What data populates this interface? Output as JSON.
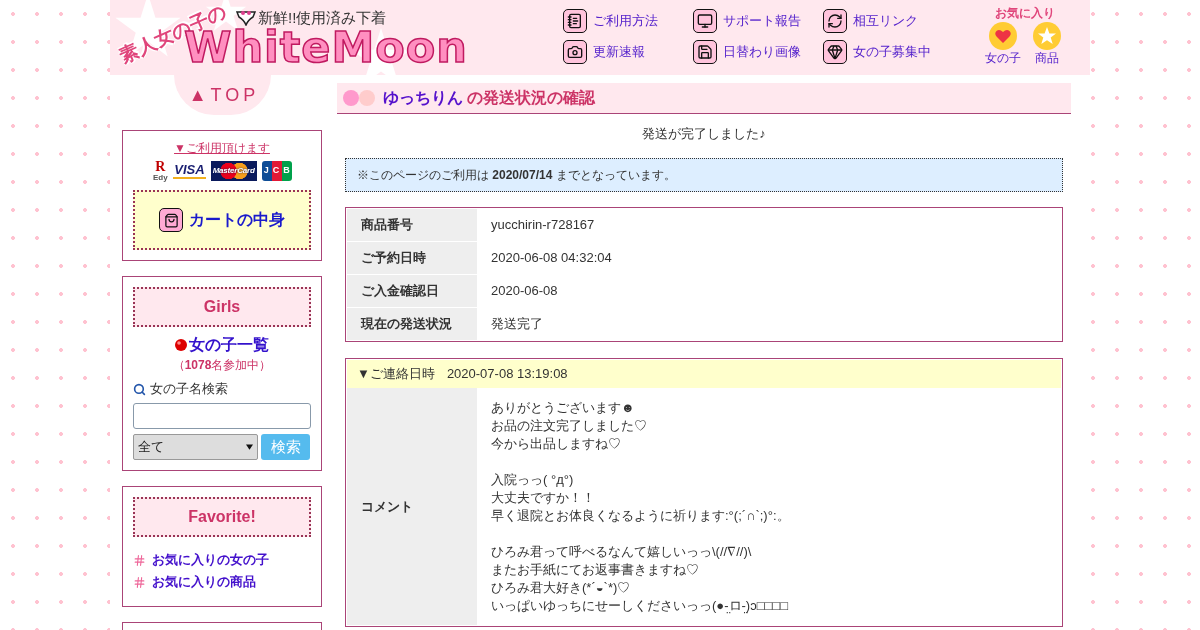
{
  "header": {
    "logo": {
      "subtitle": "素人女の子の",
      "title": "WhiteMoon",
      "tagline": "新鮮!!使用済み下着"
    },
    "nav": [
      {
        "label": "ご利用方法"
      },
      {
        "label": "サポート報告"
      },
      {
        "label": "相互リンク"
      },
      {
        "label": "更新速報"
      },
      {
        "label": "日替わり画像"
      },
      {
        "label": "女の子募集中"
      }
    ],
    "favorites": {
      "title": "お気に入り",
      "items": [
        {
          "label": "女の子"
        },
        {
          "label": "商品"
        }
      ]
    }
  },
  "sidebar": {
    "top_link": "▲TOP",
    "payment": {
      "title": "▼ご利用頂けます",
      "logos": [
        {
          "kind": "edy",
          "mark": "R",
          "text": "Edy"
        },
        {
          "kind": "visa",
          "text": "VISA"
        },
        {
          "kind": "mastercard",
          "text": "MasterCard"
        },
        {
          "kind": "jcb",
          "text": "JCB"
        }
      ],
      "cart": "カートの中身"
    },
    "girls": {
      "title": "Girls",
      "list_link": "女の子一覧",
      "count": "（**1078**名参加中）",
      "search_label": "女の子名検索",
      "select": "全て",
      "button": "検索"
    },
    "favorite": {
      "title": "Favorite!",
      "links": [
        "お気に入りの女の子",
        "お気に入りの商品"
      ]
    }
  },
  "main": {
    "title": {
      "name": "ゆっちりん",
      "text": "の発送状況の確認"
    },
    "status_message": "発送が完了しました♪",
    "notice": "※このページのご利用は **2020/07/14** までとなっています。",
    "details": [
      {
        "label": "商品番号",
        "value": "yucchirin-r728167"
      },
      {
        "label": "ご予約日時",
        "value": "2020-06-08 04:32:04"
      },
      {
        "label": "ご入金確認日",
        "value": "2020-06-08"
      },
      {
        "label": "現在の発送状況",
        "value": "発送完了"
      }
    ],
    "contact": {
      "header_label": "▼ご連絡日時",
      "date": "2020-07-08 13:19:08",
      "comment_label": "コメント",
      "paragraphs": [
        [
          "ありがとうございます☻",
          "お品の注文完了しました♡",
          "今から出品しますね♡"
        ],
        [
          "入院っっ( °д°)",
          "大丈夫ですか！！",
          "早く退院とお体良くなるように祈ります:°(;´∩`;)°:。"
        ],
        [
          "ひろみ君って呼べるなんて嬉しいっっ\\(//∇//)\\",
          "またお手紙にてお返事書きますね♡",
          "ひろみ君大好き(*´◒`*)♡",
          "いっぱいゆっちにせーしくださいっっ(●-̤ロ-̤)ɔ□□□□"
        ]
      ]
    }
  }
}
